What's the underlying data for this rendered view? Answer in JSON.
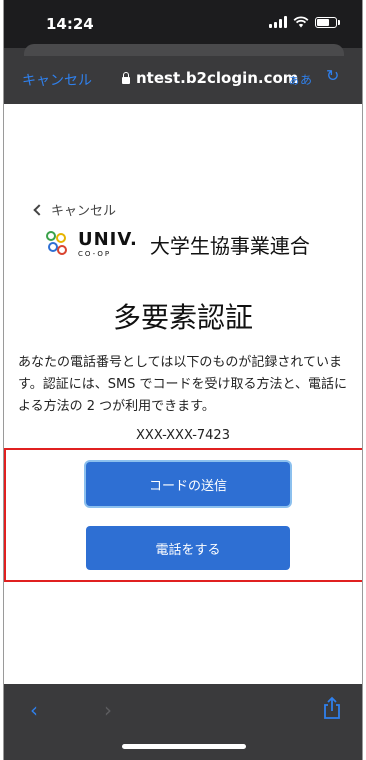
{
  "status": {
    "time": "14:24"
  },
  "browser": {
    "cancel_label": "キャンセル",
    "url": "ntest.b2clogin.com",
    "text_size_label": "ぁあ",
    "reload_icon": "reload-icon"
  },
  "page": {
    "back_label": "キャンセル",
    "logo": {
      "univ": "UNIV.",
      "coop": "CO-OP",
      "name_jp": "大学生協事業連合"
    },
    "title": "多要素認証",
    "description": "あなたの電話番号としては以下のものが記録されています。認証には、SMS でコードを受け取る方法と、電話による方法の 2 つが利用できます。",
    "phone_number": "XXX-XXX-7423",
    "send_code_label": "コードの送信",
    "call_label": "電話をする"
  },
  "colors": {
    "accent": "#2e6fd3",
    "highlight": "#e02020",
    "link": "#2f80ed"
  },
  "toolbar": {
    "back_icon": "back-icon",
    "forward_icon": "forward-icon",
    "share_icon": "share-icon"
  }
}
